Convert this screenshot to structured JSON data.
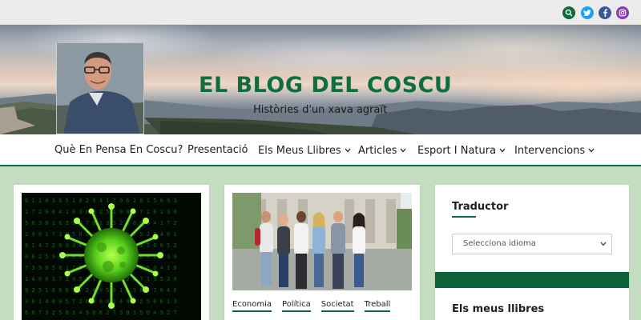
{
  "social": [
    {
      "name": "search-icon",
      "color": "#0c6a3c"
    },
    {
      "name": "twitter-icon",
      "color": "#1da1f2"
    },
    {
      "name": "facebook-icon",
      "color": "#3b5998"
    },
    {
      "name": "instagram-icon",
      "color": "#8a3ab9"
    }
  ],
  "site": {
    "title": "EL BLOG DEL COSCU",
    "tagline": "Històries d'un xava agraït"
  },
  "nav": {
    "items": [
      {
        "label": "Què En Pensa En Coscu?",
        "dropdown": false
      },
      {
        "label": "Presentació",
        "dropdown": false
      },
      {
        "label": "Els Meus Llibres",
        "dropdown": true
      },
      {
        "label": "Articles",
        "dropdown": true
      },
      {
        "label": "Esport I Natura",
        "dropdown": true
      },
      {
        "label": "Intervencions",
        "dropdown": true
      }
    ]
  },
  "posts": [
    {
      "image": "virus-matrix-image",
      "tags": []
    },
    {
      "image": "students-group-image",
      "tags": [
        "Economia",
        "Política",
        "Societat",
        "Treball"
      ]
    }
  ],
  "sidebar": {
    "translator_title": "Traductor",
    "language_select_value": "Selecciona idioma",
    "books_title": "Els meus llibres"
  },
  "colors": {
    "brand_green": "#0c6a3c",
    "page_background": "#c4dcc0"
  }
}
